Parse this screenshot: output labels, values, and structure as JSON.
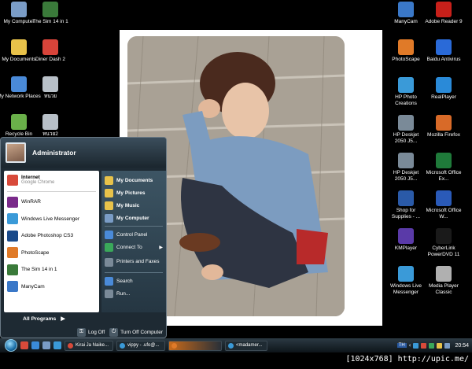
{
  "desktop_left": [
    {
      "label": "My Computer",
      "icon": "computer-icon",
      "color": "#7a9cc6"
    },
    {
      "label": "The Sim 14 in 1",
      "icon": "sims-icon",
      "color": "#3a7a3a"
    },
    {
      "label": "My Documents",
      "icon": "folder-icon",
      "color": "#e8c24a"
    },
    {
      "label": "Diner Dash 2",
      "icon": "game-icon",
      "color": "#d8443a"
    },
    {
      "label": "My Network Places",
      "icon": "network-icon",
      "color": "#4a8ad8"
    },
    {
      "label": "หนวย",
      "icon": "disk-icon",
      "color": "#b8c0c8"
    },
    {
      "label": "Recycle Bin",
      "icon": "recycle-bin-icon",
      "color": "#6ab04a"
    },
    {
      "label": "หนวย2",
      "icon": "disk-icon",
      "color": "#b8c0c8"
    }
  ],
  "desktop_right": [
    {
      "label": "ManyCam",
      "icon": "camera-icon",
      "color": "#3a78c8"
    },
    {
      "label": "Adobe Reader 9",
      "icon": "pdf-icon",
      "color": "#c8201a"
    },
    {
      "label": "PhotoScape",
      "icon": "photoscape-icon",
      "color": "#e07a28"
    },
    {
      "label": "Baidu Antivirus",
      "icon": "shield-icon",
      "color": "#2a6ad8"
    },
    {
      "label": "HP Photo Creations",
      "icon": "photo-icon",
      "color": "#3a9ad8"
    },
    {
      "label": "RealPlayer",
      "icon": "play-icon",
      "color": "#2a8ad8"
    },
    {
      "label": "HP Deskjet 2050 J5...",
      "icon": "printer-icon",
      "color": "#7a8a98"
    },
    {
      "label": "Mozilla Firefox",
      "icon": "firefox-icon",
      "color": "#d86a28"
    },
    {
      "label": "HP Deskjet 2050 J5...",
      "icon": "printer-icon",
      "color": "#7a8a98"
    },
    {
      "label": "Microsoft Office Ex...",
      "icon": "excel-icon",
      "color": "#1f7a3a"
    },
    {
      "label": "Shop for Supplies - ...",
      "icon": "shop-icon",
      "color": "#2a5aa8"
    },
    {
      "label": "Microsoft Office W...",
      "icon": "word-icon",
      "color": "#2a5ab8"
    },
    {
      "label": "KMPlayer",
      "icon": "kmplayer-icon",
      "color": "#5a3aa8"
    },
    {
      "label": "CyberLink PowerDVD 11",
      "icon": "dvd-icon",
      "color": "#1a1a1a"
    },
    {
      "label": "Windows Live Messenger",
      "icon": "messenger-icon",
      "color": "#3a9ad8"
    },
    {
      "label": "Media Player Classic",
      "icon": "media-player-icon",
      "color": "#b0b0b0"
    }
  ],
  "start_menu": {
    "user": "Administrator",
    "pinned": [
      {
        "label": "Internet",
        "sub": "Google Chrome",
        "icon": "chrome-icon",
        "color": "#d84a3a"
      }
    ],
    "recent": [
      {
        "label": "WinRAR",
        "icon": "winrar-icon",
        "color": "#7a2a8a"
      },
      {
        "label": "Windows Live Messenger",
        "icon": "messenger-icon",
        "color": "#3a9ad8"
      },
      {
        "label": "Adobe Photoshop CS3",
        "icon": "photoshop-icon",
        "color": "#1a4a8a"
      },
      {
        "label": "PhotoScape",
        "icon": "photoscape-icon",
        "color": "#e07a28"
      },
      {
        "label": "The Sim 14 in 1",
        "icon": "sims-icon",
        "color": "#3a7a3a"
      },
      {
        "label": "ManyCam",
        "icon": "camera-icon",
        "color": "#3a78c8"
      }
    ],
    "all_programs": "All Programs",
    "right_group1": [
      {
        "label": "My Documents",
        "icon": "folder-icon",
        "color": "#e8c24a"
      },
      {
        "label": "My Pictures",
        "icon": "folder-icon",
        "color": "#e8c24a"
      },
      {
        "label": "My Music",
        "icon": "folder-icon",
        "color": "#e8c24a"
      },
      {
        "label": "My Computer",
        "icon": "computer-icon",
        "color": "#7a9cc6"
      }
    ],
    "right_group2": [
      {
        "label": "Control Panel",
        "icon": "control-panel-icon",
        "color": "#4a8ad8"
      },
      {
        "label": "Connect To",
        "icon": "globe-icon",
        "color": "#3aa85a"
      },
      {
        "label": "Printers and Faxes",
        "icon": "printer-icon",
        "color": "#7a8a98"
      }
    ],
    "right_group3": [
      {
        "label": "Search",
        "icon": "search-icon",
        "color": "#4a8ad8"
      },
      {
        "label": "Run...",
        "icon": "run-icon",
        "color": "#7a8a98"
      }
    ],
    "log_off": "Log Off",
    "turn_off": "Turn Off Computer"
  },
  "taskbar": {
    "tasks": [
      {
        "label": "Kirai Ja Naike...",
        "color": "#d84a3a"
      },
      {
        "label": "vippy - .ufo@...",
        "color": "#3a9ad8"
      },
      {
        "label": "",
        "color": "#e07a28"
      },
      {
        "label": "<madamer...",
        "color": "#3a9ad8"
      }
    ],
    "lang": "TH",
    "clock": "20:54"
  },
  "caption": "[1024x768] http://upic.me/"
}
